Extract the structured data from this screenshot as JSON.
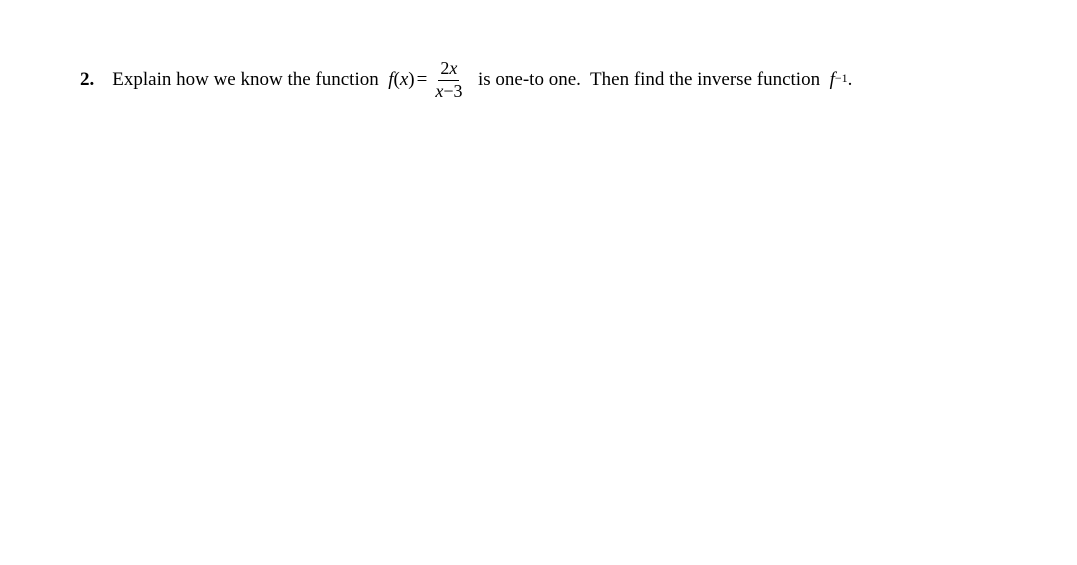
{
  "problem": {
    "number": "2.",
    "text_before": "Explain how we know the function  ",
    "func_name": "f",
    "func_arg_open": "(",
    "func_var": "x",
    "func_arg_close": ")",
    "equals": "=",
    "fraction": {
      "num_coef": "2",
      "num_var": "x",
      "den_var": "x",
      "den_op": "−",
      "den_const": "3"
    },
    "text_mid": "  is one-to one.  Then find the inverse function  ",
    "inv_func_name": "f",
    "inv_exp": "−1",
    "period": "."
  }
}
